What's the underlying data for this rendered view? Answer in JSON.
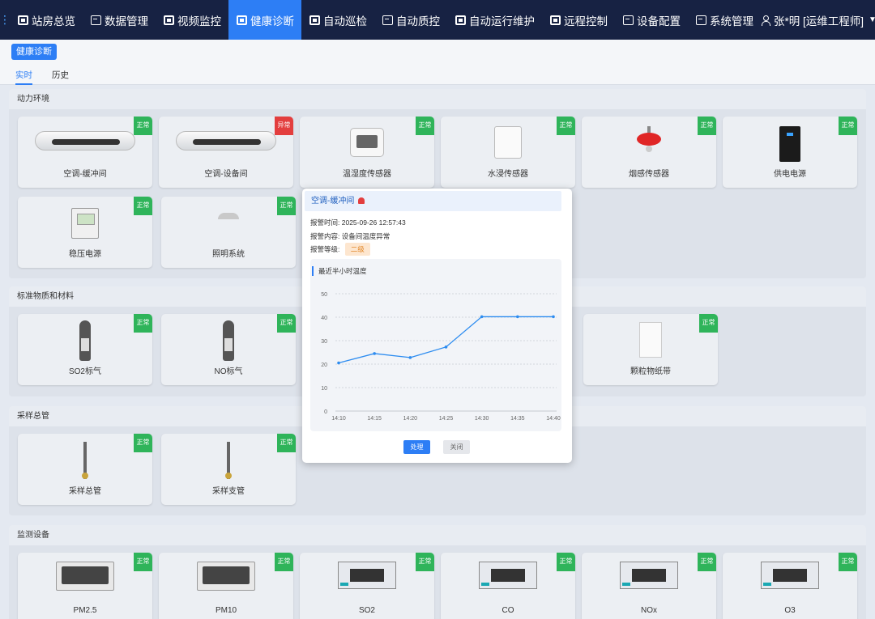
{
  "nav": {
    "items": [
      {
        "label": "站房总览",
        "active": false,
        "icon": "dashboard-icon"
      },
      {
        "label": "数据管理",
        "active": false,
        "icon": "data-icon"
      },
      {
        "label": "视频监控",
        "active": false,
        "icon": "video-icon"
      },
      {
        "label": "健康诊断",
        "active": true,
        "icon": "health-icon"
      },
      {
        "label": "自动巡检",
        "active": false,
        "icon": "inspect-icon"
      },
      {
        "label": "自动质控",
        "active": false,
        "icon": "quality-icon"
      },
      {
        "label": "自动运行维护",
        "active": false,
        "icon": "maintain-icon"
      },
      {
        "label": "远程控制",
        "active": false,
        "icon": "remote-icon"
      },
      {
        "label": "设备配置",
        "active": false,
        "icon": "config-icon"
      },
      {
        "label": "系统管理",
        "active": false,
        "icon": "system-icon"
      }
    ],
    "user": "张*明  [运维工程师]"
  },
  "page_tag": "健康诊断",
  "tabs": {
    "realtime": "实时",
    "history": "历史"
  },
  "status": {
    "ok": "正常",
    "bad": "异常"
  },
  "sections": {
    "power": {
      "title": "动力环境",
      "cards": [
        {
          "label": "空调-缓冲间",
          "status": "ok"
        },
        {
          "label": "空调-设备间",
          "status": "bad"
        },
        {
          "label": "温湿度传感器",
          "status": "ok"
        },
        {
          "label": "水浸传感器",
          "status": "ok"
        },
        {
          "label": "烟感传感器",
          "status": "ok"
        },
        {
          "label": "供电电源",
          "status": "ok"
        },
        {
          "label": "稳压电源",
          "status": "ok"
        },
        {
          "label": "照明系统",
          "status": "ok"
        }
      ]
    },
    "standard": {
      "title": "标准物质和材料",
      "cards": [
        {
          "label": "SO2标气",
          "status": "ok"
        },
        {
          "label": "NO标气",
          "status": "ok"
        },
        {
          "label": "颗粒物纸带",
          "status": "ok"
        }
      ]
    },
    "sampling": {
      "title": "采样总管",
      "cards": [
        {
          "label": "采样总管",
          "status": "ok"
        },
        {
          "label": "采样支管",
          "status": "ok"
        }
      ]
    },
    "monitor": {
      "title": "监测设备",
      "cards": [
        {
          "label": "PM2.5",
          "status": "ok"
        },
        {
          "label": "PM10",
          "status": "ok"
        },
        {
          "label": "SO2",
          "status": "ok"
        },
        {
          "label": "CO",
          "status": "ok"
        },
        {
          "label": "NOx",
          "status": "ok"
        },
        {
          "label": "O3",
          "status": "ok"
        }
      ]
    }
  },
  "popup": {
    "title": "空调-缓冲间",
    "time_label": "报警时间:",
    "time_value": "2025-09-26 12:57:43",
    "content_label": "报警内容:",
    "content_value": "设备间温度异常",
    "level_label": "报警等级:",
    "level_value": "二级",
    "chart_title": "最近半小时温度",
    "handle_label": "处理",
    "close_label": "关闭"
  },
  "chart_data": {
    "type": "line",
    "title": "最近半小时温度",
    "x": [
      "14:10",
      "14:15",
      "14:20",
      "14:25",
      "14:30",
      "14:35",
      "14:40"
    ],
    "values": [
      20.5,
      24.5,
      22.8,
      27.3,
      40.2,
      40.2,
      40.2
    ],
    "yticks": [
      0,
      10,
      20,
      30,
      40,
      50
    ],
    "ylim": [
      0,
      50
    ],
    "grid": true,
    "color": "#2d8cf0"
  }
}
